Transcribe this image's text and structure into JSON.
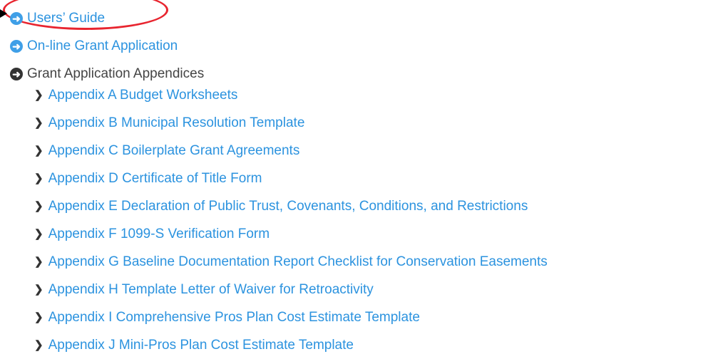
{
  "links": [
    {
      "label": "Users’ Guide",
      "icon": "arrow-circle-right-icon",
      "style": "link"
    },
    {
      "label": "On-line Grant Application",
      "icon": "arrow-circle-right-icon",
      "style": "link"
    },
    {
      "label": "Grant Application Appendices",
      "icon": "arrow-circle-right-icon",
      "style": "plain"
    }
  ],
  "appendices": [
    "Appendix A Budget Worksheets",
    "Appendix B Municipal Resolution Template",
    "Appendix C Boilerplate Grant Agreements",
    "Appendix D Certificate of Title Form",
    "Appendix E Declaration of Public Trust, Covenants, Conditions, and Restrictions",
    "Appendix F 1099-S Verification Form",
    "Appendix G Baseline Documentation Report Checklist for Conservation Easements",
    "Appendix H Template Letter of Waiver for Retroactivity",
    "Appendix I Comprehensive Pros Plan Cost Estimate Template",
    "Appendix J Mini-Pros Plan Cost Estimate Template"
  ],
  "colors": {
    "link": "#2c93df",
    "icon_blue": "#3f9fe7",
    "icon_dark": "#333333",
    "annotation": "#e8252f"
  }
}
